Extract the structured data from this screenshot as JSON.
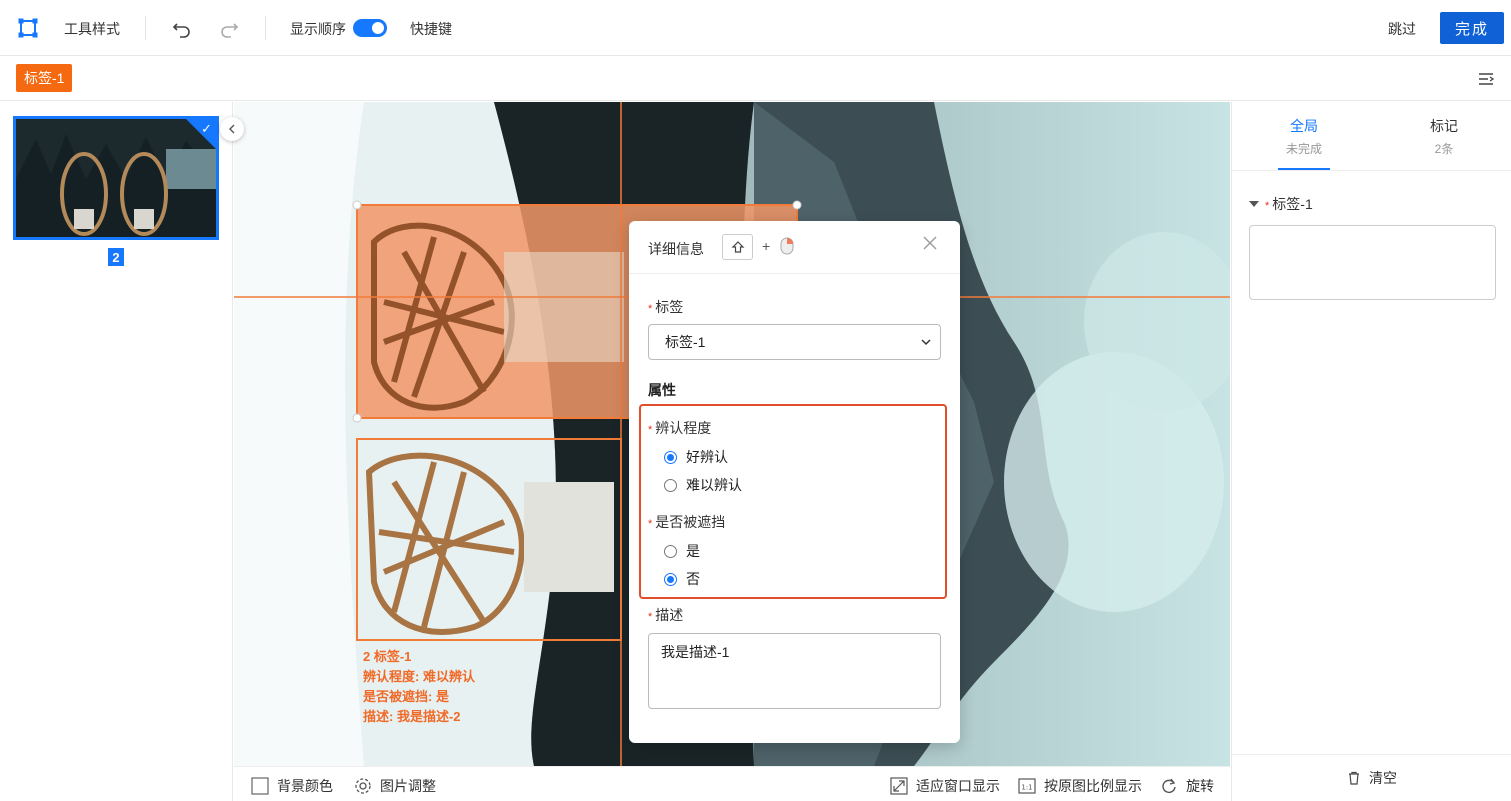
{
  "toolbar": {
    "tool_style": "工具样式",
    "show_order": "显示顺序",
    "show_order_on": true,
    "shortcuts": "快捷键",
    "skip": "跳过",
    "done": "完成"
  },
  "labelbar": {
    "active_label": "标签-1"
  },
  "thumbnails": [
    {
      "number": "2",
      "selected": true
    }
  ],
  "annotation_overlay": {
    "lines": [
      "2 标签-1",
      "辨认程度: 难以辨认",
      "是否被遮挡: 是",
      "描述: 我是描述-2"
    ]
  },
  "popup": {
    "title": "详细信息",
    "plus": "+",
    "label_field": "标签",
    "label_value": "标签-1",
    "attributes_title": "属性",
    "recognizability": {
      "label": "辨认程度",
      "options": [
        {
          "label": "好辨认",
          "selected": true
        },
        {
          "label": "难以辨认",
          "selected": false
        }
      ]
    },
    "occluded": {
      "label": "是否被遮挡",
      "options": [
        {
          "label": "是",
          "selected": false
        },
        {
          "label": "否",
          "selected": true
        }
      ]
    },
    "description_label": "描述",
    "description_value": "我是描述-1"
  },
  "bottombar": {
    "bg_color": "背景颜色",
    "image_adjust": "图片调整",
    "fit_window": "适应窗口显示",
    "original_ratio": "按原图比例显示",
    "rotate": "旋转"
  },
  "rightpanel": {
    "tabs": [
      {
        "label": "全局",
        "sub": "未完成",
        "active": true
      },
      {
        "label": "标记",
        "sub": "2条",
        "active": false
      }
    ],
    "label_item": "标签-1",
    "clear": "清空"
  },
  "colors": {
    "accent": "#1677ff",
    "label_orange": "#f56a10",
    "highlight_red": "#e24d2b"
  }
}
